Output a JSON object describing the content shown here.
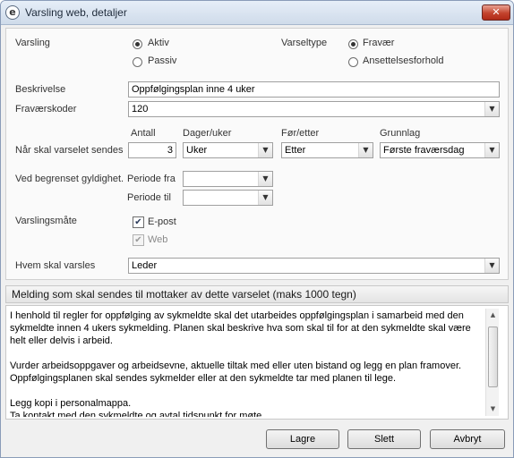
{
  "window": {
    "title": "Varsling web, detaljer",
    "close_glyph": "✕"
  },
  "form": {
    "varsling": {
      "label": "Varsling",
      "options": [
        {
          "label": "Aktiv",
          "checked": true
        },
        {
          "label": "Passiv",
          "checked": false
        }
      ]
    },
    "varseltype": {
      "label": "Varseltype",
      "options": [
        {
          "label": "Fravær",
          "checked": true
        },
        {
          "label": "Ansettelsesforhold",
          "checked": false
        }
      ]
    },
    "beskrivelse": {
      "label": "Beskrivelse",
      "value": "Oppfølgingsplan inne 4 uker"
    },
    "fravaerskoder": {
      "label": "Fraværskoder",
      "value": "120"
    },
    "varsel_sendes": {
      "label": "Når skal varselet sendes",
      "antall": {
        "header": "Antall",
        "value": "3"
      },
      "dager_uker": {
        "header": "Dager/uker",
        "value": "Uker"
      },
      "for_etter": {
        "header": "Før/etter",
        "value": "Etter"
      },
      "grunnlag": {
        "header": "Grunnlag",
        "value": "Første fraværsdag"
      }
    },
    "gyldighet": {
      "label": "Ved begrenset gyldighet.",
      "periode_fra": {
        "label": "Periode fra",
        "value": ""
      },
      "periode_til": {
        "label": "Periode til",
        "value": ""
      }
    },
    "varslingsmate": {
      "label": "Varslingsmåte",
      "options": [
        {
          "label": "E-post",
          "checked": true,
          "enabled": true
        },
        {
          "label": "Web",
          "checked": true,
          "enabled": false
        }
      ]
    },
    "hvem": {
      "label": "Hvem skal varsles",
      "value": "Leder"
    }
  },
  "message": {
    "header": "Melding som skal sendes til mottaker av dette varselet (maks 1000 tegn)",
    "paragraphs": [
      "I henhold til regler for oppfølging av sykmeldte skal det utarbeides oppfølgingsplan i samarbeid med den sykmeldte innen 4 ukers sykmelding. Planen skal beskrive hva som skal til for at den sykmeldte skal være helt eller delvis i arbeid.",
      "Vurder arbeidsoppgaver og arbeidsevne, aktuelle tiltak med eller uten bistand og legg en plan framover. Oppfølgingsplanen skal sendes sykmelder eller at den sykmeldte tar med planen til lege.",
      "Legg kopi i personalmappa.\nTa kontakt med den sykmeldte og avtal tidspunkt for møte."
    ]
  },
  "buttons": {
    "save": "Lagre",
    "delete": "Slett",
    "cancel": "Avbryt"
  },
  "icons": {
    "app": "e-logo-icon",
    "dropdown": "chevron-down-icon",
    "check": "checkmark-icon",
    "scroll_up": "scroll-up-icon",
    "scroll_down": "scroll-down-icon"
  }
}
